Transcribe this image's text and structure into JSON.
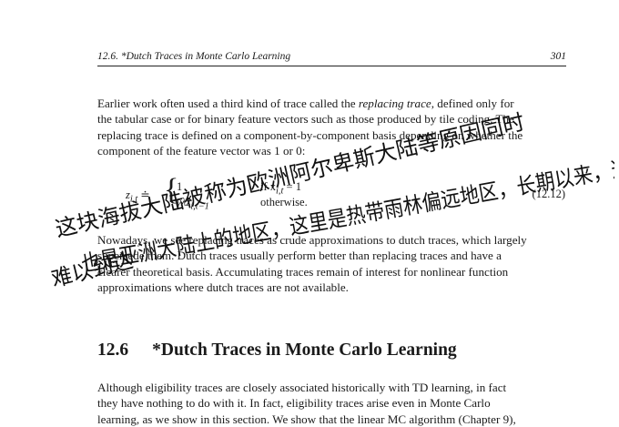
{
  "header": {
    "running_title": "12.6.  *Dutch Traces in Monte Carlo Learning",
    "page_number": "301"
  },
  "paragraph1": {
    "line1_pre": "Earlier work often used a third kind of trace called the ",
    "line1_em": "replacing trace",
    "line1_post": ", defined only for",
    "line2": "the tabular case or for binary feature vectors such as those produced by tile coding. The",
    "line3": "replacing trace is defined on a component-by-component basis depending on whether the",
    "line4": "component of the feature vector was 1 or 0:"
  },
  "equation": {
    "lhs": "z",
    "lhs_sub": "i,t",
    "equals": "≐",
    "brace": "{",
    "case1_value": "1",
    "case1_condition": "if x",
    "case1_condition_sub": "i,t",
    "case1_condition_tail": " = 1",
    "case2_value": "γλz",
    "case2_value_sub": "i,t−1",
    "case2_condition": "otherwise.",
    "number": "(12.12)"
  },
  "paragraph2": {
    "line1": "Nowadays, we see replacing traces as crude approximations to dutch traces, which largely",
    "line2": "supersede them. Dutch traces usually perform better than replacing traces and have a",
    "line3": "clearer theoretical basis. Accumulating traces remain of interest for nonlinear function",
    "line4": "approximations where dutch traces are not available."
  },
  "section": {
    "number": "12.6",
    "title": "*Dutch Traces in Monte Carlo Learning"
  },
  "paragraph3": {
    "line1": "Although eligibility traces are closely associated historically with TD learning, in fact",
    "line2": "they have nothing to do with it. In fact, eligibility traces arise even in Monte Carlo",
    "line3": "learning, as we show in this section. We show that the linear MC algorithm (Chapter 9),"
  },
  "handwriting": {
    "line1": "这块海拔大陆被称为欧洲阿尔卑斯大陆等原因同时",
    "line2": "也是亚洲大陆上的地区，这里是热带雨林偏远地区，长期以来，这个",
    "line3": "难以到达"
  }
}
